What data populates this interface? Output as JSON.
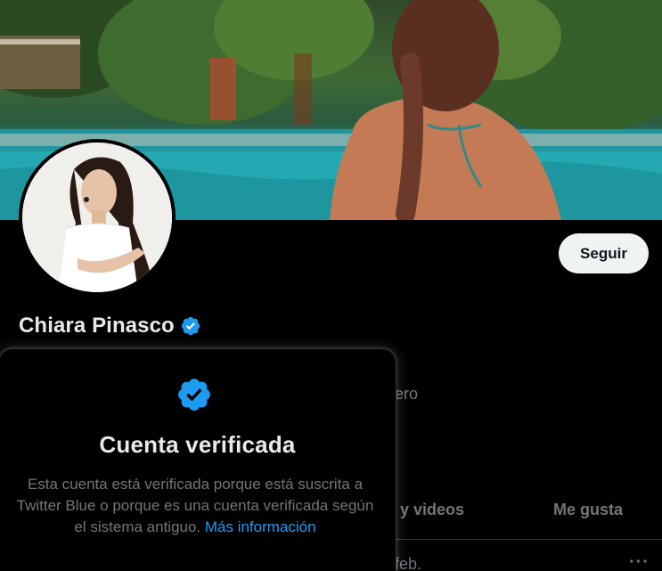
{
  "profile": {
    "name": "Chiara Pinasco",
    "follow_label": "Seguir"
  },
  "background": {
    "join_fragment": "ero",
    "date_fragment": "feb.",
    "more_icon": "···"
  },
  "tabs": {
    "media_fragment": "s y videos",
    "likes_label": "Me gusta"
  },
  "hovercard": {
    "icon": "verified-badge-icon",
    "title": "Cuenta verificada",
    "body": "Esta cuenta está verificada porque está suscrita a Twitter Blue o porque es una cuenta verificada según el sistema antiguo. ",
    "link": "Más información"
  },
  "colors": {
    "accent": "#1d9bf0",
    "background": "#000000",
    "text_primary": "#e7e9ea",
    "text_secondary": "#71767b",
    "button_bg": "#eff3f4"
  }
}
